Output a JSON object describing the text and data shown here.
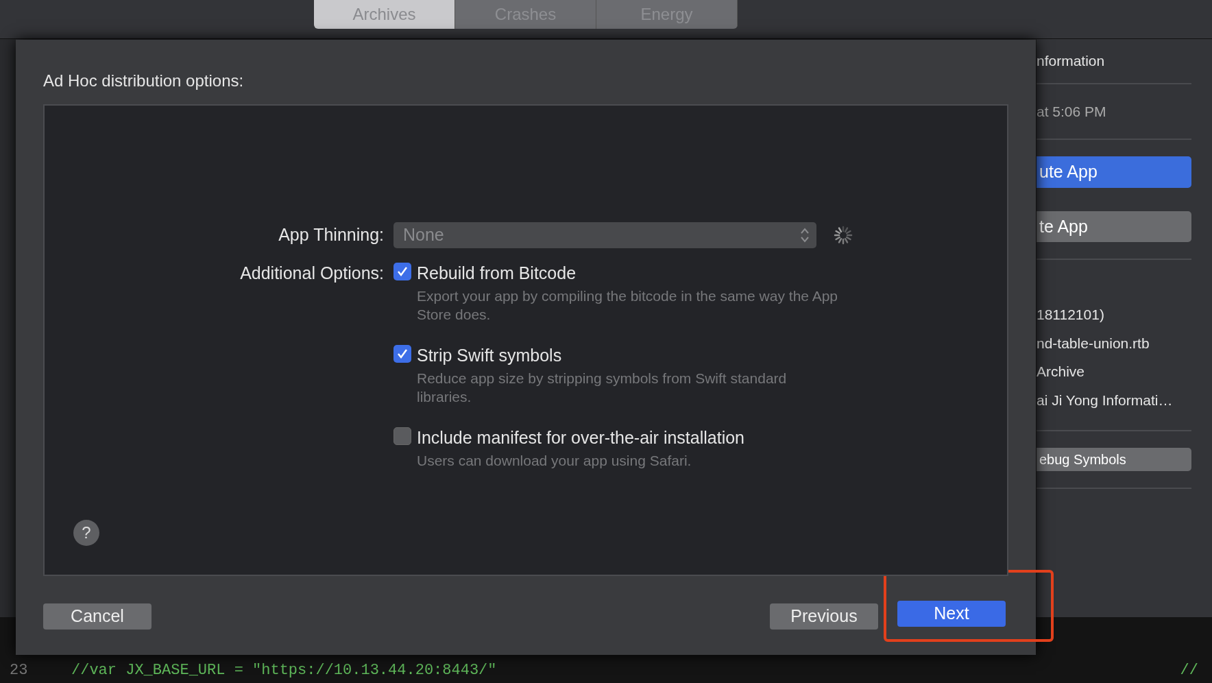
{
  "tabs": [
    {
      "label": "Archives",
      "selected": true
    },
    {
      "label": "Crashes",
      "selected": false
    },
    {
      "label": "Energy",
      "selected": false
    }
  ],
  "inspector": {
    "heading": "nformation",
    "date": "at 5:06 PM",
    "primary_button": "ute App",
    "secondary_button": "te App",
    "details": [
      "18112101)",
      "nd-table-union.rtb",
      "Archive",
      "ai Ji Yong Informati…"
    ],
    "symbols_button": "ebug Symbols"
  },
  "dialog": {
    "title": "Ad Hoc distribution options:",
    "thinning": {
      "label": "App Thinning:",
      "value": "None",
      "loading": true
    },
    "options_label": "Additional Options:",
    "options": [
      {
        "label": "Rebuild from Bitcode",
        "description": "Export your app by compiling the bitcode in the same way the App Store does.",
        "checked": true
      },
      {
        "label": "Strip Swift symbols",
        "description": "Reduce app size by stripping symbols from Swift standard libraries.",
        "checked": true
      },
      {
        "label": "Include manifest for over-the-air installation",
        "description": "Users can download your app using Safari.",
        "checked": false
      }
    ],
    "help": "?",
    "buttons": [
      {
        "label": "Cancel",
        "kind": "plain",
        "highlighted": false
      },
      {
        "label": "Previous",
        "kind": "plain",
        "highlighted": false
      },
      {
        "label": "Next",
        "kind": "default",
        "highlighted": true
      }
    ]
  },
  "editor": {
    "line_number": "23",
    "code": "//var JX_BASE_URL = \"https://10.13.44.20:8443/\"",
    "comment": "//"
  }
}
